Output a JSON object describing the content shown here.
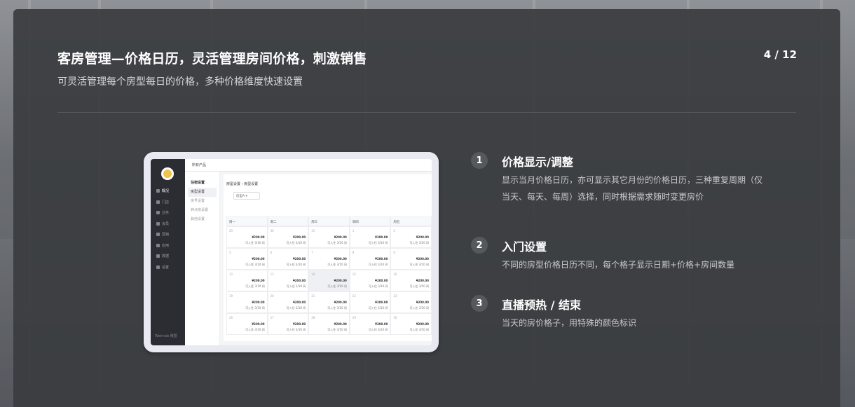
{
  "header": {
    "title": "客房管理—价格日历，灵活管理房间价格，刺激销售",
    "subtitle": "可灵活管理每个房型每日的价格，多种价格维度快速设置",
    "pager": "4 / 12"
  },
  "mockup": {
    "top_label": "所有产品",
    "brand": "Weimob 微盟",
    "nav": [
      "概况",
      "门店",
      "业务",
      "会员",
      "营销",
      "应用",
      "数据",
      "设置"
    ],
    "sub_nav": [
      "住宿设置",
      "房型设置",
      "房号设置",
      "钟点房设置",
      "其他设置"
    ],
    "breadcrumb": "房型设置 › 房型设置",
    "select": "房型A",
    "weekdays": [
      "周一",
      "周二",
      "周三",
      "周四",
      "周五"
    ],
    "rows": [
      [
        "29",
        "30",
        "31",
        "1",
        "2"
      ],
      [
        "5",
        "6",
        "7",
        "8",
        "9"
      ],
      [
        "12",
        "13",
        "14",
        "15",
        "16"
      ],
      [
        "19",
        "20",
        "21",
        "22",
        "23"
      ],
      [
        "26",
        "27",
        "28",
        "29",
        "30"
      ]
    ],
    "price": "¥200.00",
    "qty": "可入住 3/10 间"
  },
  "features": [
    {
      "num": "1",
      "title": "价格显示/调整",
      "desc": "显示当月价格日历，亦可显示其它月份的价格日历，三种重复周期（仅当天、每天、每周）选择，同时根据需求随时变更房价"
    },
    {
      "num": "2",
      "title": "入门设置",
      "desc": "不同的房型价格日历不同，每个格子显示日期+价格+房间数量"
    },
    {
      "num": "3",
      "title": "直播预热 / 结束",
      "desc": "当天的房价格子，用特殊的颜色标识"
    }
  ]
}
